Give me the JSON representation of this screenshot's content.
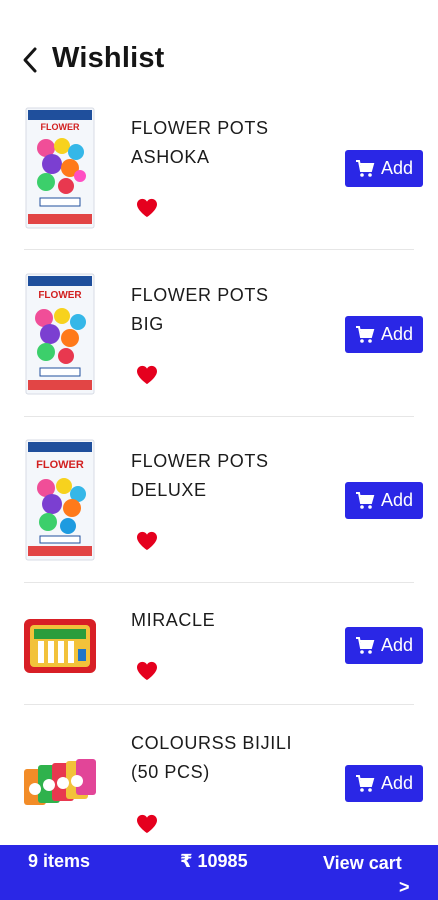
{
  "header": {
    "title": "Wishlist"
  },
  "items": [
    {
      "name_line1": "FLOWER POTS",
      "name_line2": "ASHOKA",
      "add_label": "Add",
      "image": "flower-pots-box"
    },
    {
      "name_line1": "FLOWER POTS",
      "name_line2": "BIG",
      "add_label": "Add",
      "image": "flower-pots-box"
    },
    {
      "name_line1": "FLOWER POTS",
      "name_line2": "DELUXE",
      "add_label": "Add",
      "image": "flower-pots-box"
    },
    {
      "name_line1": "MIRACLE",
      "name_line2": "",
      "add_label": "Add",
      "image": "miracle-pack"
    },
    {
      "name_line1": "COLOURSS BIJILI",
      "name_line2": "(50 PCS)",
      "add_label": "Add",
      "image": "bijili-packs"
    }
  ],
  "bottom_bar": {
    "items_count": "9 items",
    "total": "₹ 10985",
    "view_cart": "View cart",
    "view_cart_chevron": ">"
  },
  "colors": {
    "accent": "#2a27e6",
    "heart": "#e5001e"
  }
}
